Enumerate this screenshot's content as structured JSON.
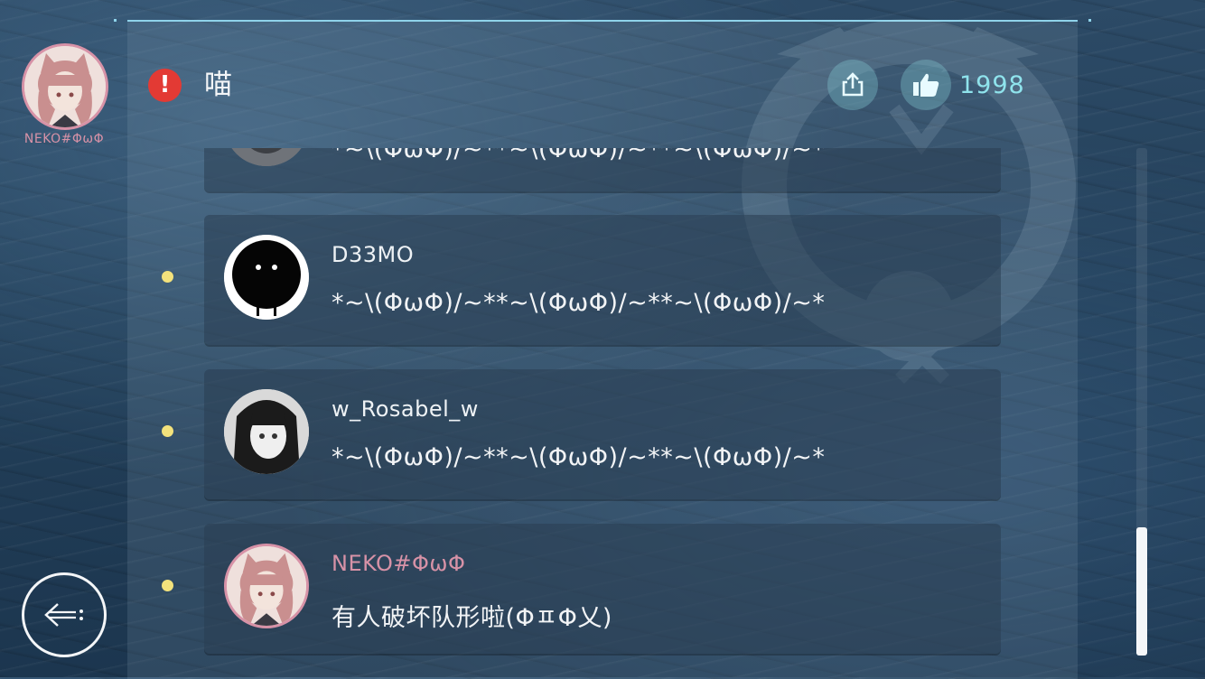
{
  "sidebar": {
    "user_name": "NEKO#ΦωΦ",
    "avatar_icon": "anime-cat-girl-avatar"
  },
  "header": {
    "title": "喵",
    "warning_icon": "exclamation-icon",
    "share_icon": "share-icon",
    "like_icon": "thumbs-up-icon",
    "like_count": "1998"
  },
  "comments": [
    {
      "user": "",
      "message": "*~\\(ΦωΦ)/~**~\\(ΦωΦ)/~**~\\(ΦωΦ)/~*",
      "name_color": "#eef2f5",
      "avatar": "grey-avatar"
    },
    {
      "user": "D33MO",
      "message": "*~\\(ΦωΦ)/~**~\\(ΦωΦ)/~**~\\(ΦωΦ)/~*",
      "name_color": "#eef2f5",
      "avatar": "black-blob-avatar"
    },
    {
      "user": "w_Rosabel_w",
      "message": "*~\\(ΦωΦ)/~**~\\(ΦωΦ)/~**~\\(ΦωΦ)/~*",
      "name_color": "#eef2f5",
      "avatar": "dark-hair-girl-avatar"
    },
    {
      "user": "NEKO#ΦωΦ",
      "message": "有人破坏队形啦(ΦㅍΦ乂)",
      "name_color": "#d792a7",
      "avatar": "anime-cat-girl-avatar"
    }
  ],
  "controls": {
    "back_icon": "back-arrow-icon"
  },
  "colors": {
    "accent": "#8fd3ea",
    "warning": "#e33a34",
    "own_name": "#d792a7",
    "dot": "#f3e27c"
  }
}
